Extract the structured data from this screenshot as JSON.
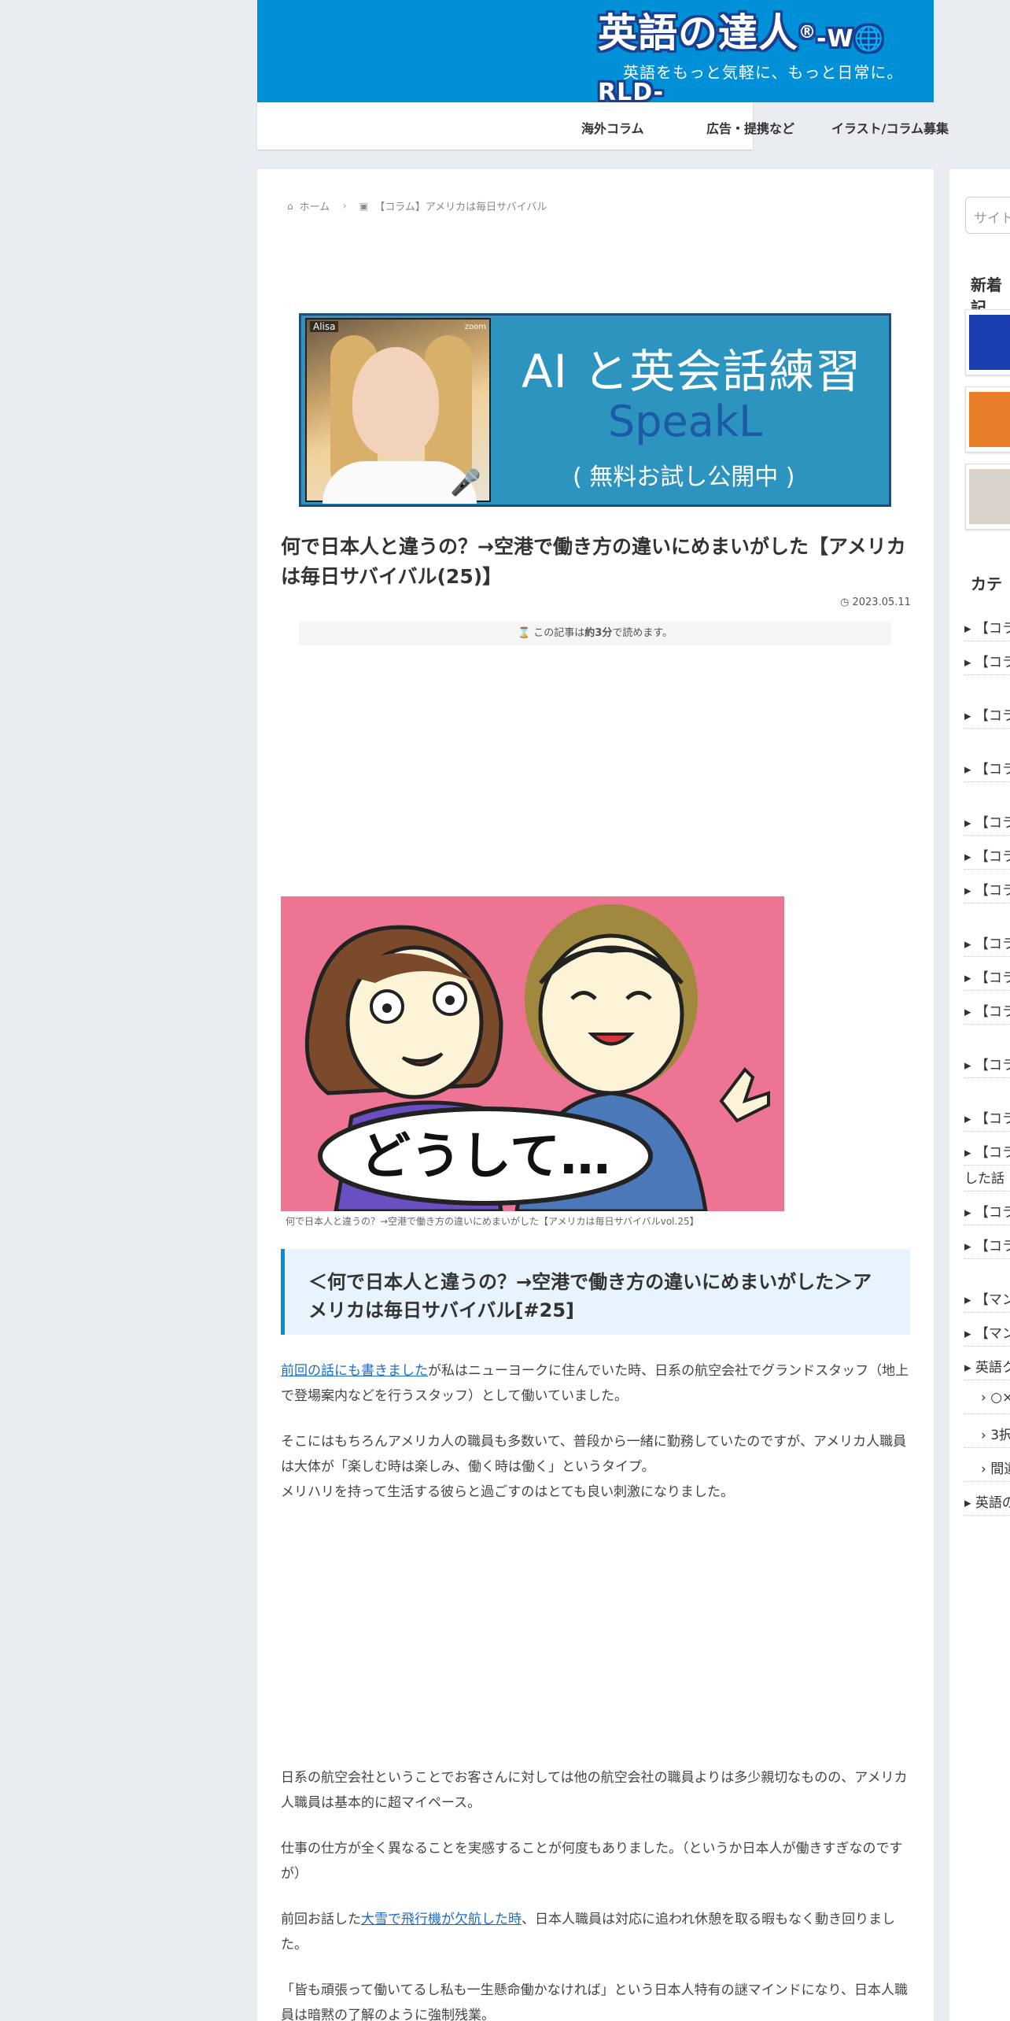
{
  "header": {
    "logo_main": "英語の達人",
    "logo_reg": "®",
    "logo_world": "-W🌐RLD-",
    "logo_sub": "英語をもっと気軽に、もっと日常に。",
    "brand_color": "#0090d8"
  },
  "nav": {
    "items": [
      "海外コラム",
      "広告・提携など",
      "イラスト/コラム募集"
    ]
  },
  "breadcrumb": {
    "home": "ホーム",
    "current": "【コラム】アメリカは毎日サバイバル"
  },
  "ad_banner": {
    "title1": "AI と英会話練習",
    "title2": "SpeakL",
    "title3": "( 無料お試し公開中 )",
    "photo_tag": "Alisa",
    "zoom_label": "zoom"
  },
  "post": {
    "title": "何で日本人と違うの？→空港で働き方の違いにめまいがした【アメリカは毎日サバイバル(25)】",
    "date": "2023.05.11",
    "read_time_prefix": "この記事は",
    "read_time_value": "約3分",
    "read_time_suffix": "で読めます。",
    "eyecatch_text": "どうして…",
    "caption": "何で日本人と違うの？→空港で働き方の違いにめまいがした【アメリカは毎日サバイバルvol.25】",
    "h2": "＜何で日本人と違うの？→空港で働き方の違いにめまいがした＞アメリカは毎日サバイバル[#25]",
    "p1_link": "前回の話にも書きました",
    "p1_rest": "が私はニューヨークに住んでいた時、日系の航空会社でグランドスタッフ（地上で登場案内などを行うスタッフ）として働いていました。",
    "p2": "そこにはもちろんアメリカ人の職員も多数いて、普段から一緒に勤務していたのですが、アメリカ人職員は大体が「楽しむ時は楽しみ、働く時は働く」というタイプ。",
    "p2b": "メリハリを持って生活する彼らと過ごすのはとても良い刺激になりました。",
    "p3": "日系の航空会社ということでお客さんに対しては他の航空会社の職員よりは多少親切なものの、アメリカ人職員は基本的に超マイペース。",
    "p4": "仕事の仕方が全く異なることを実感することが何度もありました。（というか日本人が働きすぎなのですが）",
    "p5_pre": "前回お話した",
    "p5_link": "大雪で飛行機が欠航した時",
    "p5_rest": "、日本人職員は対応に追われ休憩を取る暇もなく動き回りました。",
    "p6": "「皆も頑張って働いてるし私も一生懸命働かなければ」という日本人特有の謎マインドになり、日本人職員は暗黙の了解のように強制残業。"
  },
  "sidebar": {
    "search_placeholder": "サイト",
    "new_heading": "新着記",
    "cat_heading": "カテ",
    "categories": [
      "【コラ",
      "【コラ",
      "【コラ",
      "【コラ",
      "【コラ",
      "【コラ",
      "【コラ",
      "【コラ",
      "【コラ",
      "【コラ",
      "【コラ",
      "【コラ",
      "【コラ",
      "した話",
      "【コラ",
      "【コラ",
      "【マン",
      "【マン",
      "英語ク",
      "○×",
      "3択",
      "間違",
      "英語の"
    ]
  }
}
